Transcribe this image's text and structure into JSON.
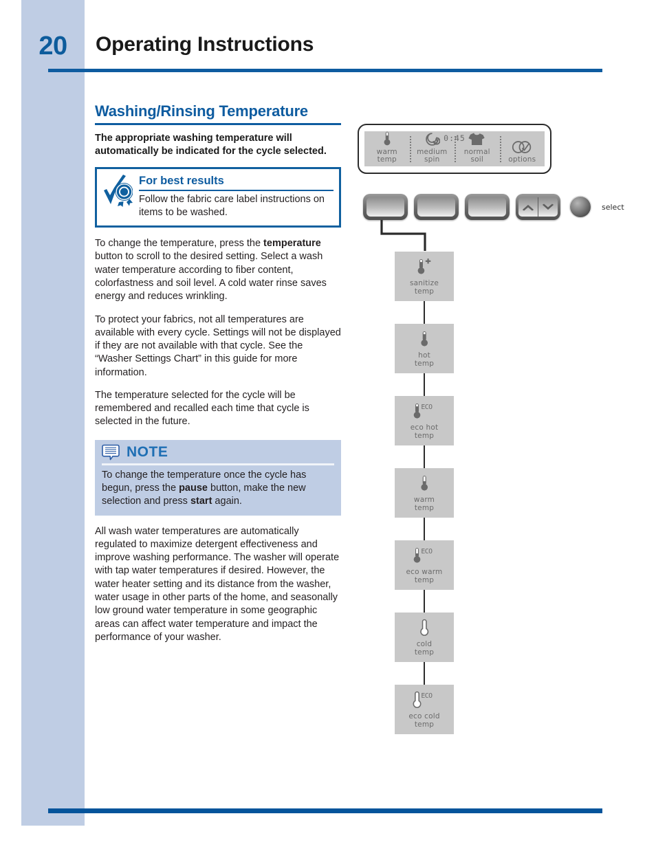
{
  "page": {
    "number": "20",
    "title": "Operating Instructions"
  },
  "section": {
    "heading": "Washing/Rinsing Temperature",
    "lead": "The appropriate washing temperature will automatically be indicated for the cycle selected.",
    "paragraphs": [
      {
        "parts": [
          {
            "text": "To change the temperature, press the ",
            "bold": false
          },
          {
            "text": "temperature",
            "bold": true
          },
          {
            "text": " button to scroll to the desired setting. Select a wash water temperature according to fiber content, colorfastness and soil level. A cold water rinse saves energy and reduces wrinkling.",
            "bold": false
          }
        ]
      },
      {
        "parts": [
          {
            "text": "To protect your fabrics, not all temperatures are available with every cycle. Settings will not be displayed if they are not available with that cycle. See the “Washer Settings Chart” in this guide for more information.",
            "bold": false
          }
        ]
      },
      {
        "parts": [
          {
            "text": "The temperature selected for the cycle will be remembered and recalled each time that cycle is selected in the future.",
            "bold": false
          }
        ]
      }
    ],
    "closing": {
      "parts": [
        {
          "text": "All wash water temperatures are automatically regulated to maximize detergent effectiveness and improve washing performance. The washer will operate with tap water temperatures if desired. However, the water heater setting and its distance from the washer, water usage in other parts of the home, and seasonally low ground water temperature in some geographic areas can affect water temperature and impact the performance of your washer.",
          "bold": false
        }
      ]
    }
  },
  "tip_box": {
    "icon": "award-rosette-checkmark-icon",
    "title": "For best results",
    "text": "Follow the fabric care label instructions on items to be washed."
  },
  "note_box": {
    "icon": "note-speech-bubble-icon",
    "title": "NOTE",
    "parts": [
      {
        "text": "To change the temperature once the cycle has begun, press the ",
        "bold": false
      },
      {
        "text": "pause",
        "bold": true
      },
      {
        "text": " button, make the new selection and press ",
        "bold": false
      },
      {
        "text": "start",
        "bold": true
      },
      {
        "text": " again.",
        "bold": false
      }
    ]
  },
  "control_panel": {
    "display": {
      "timer": "0:45",
      "cells": [
        {
          "icon": "thermometer-warm-icon",
          "label": "warm\ntemp"
        },
        {
          "icon": "spin-spiral-icon",
          "label": "medium\nspin"
        },
        {
          "icon": "tshirt-soil-icon",
          "label": "normal\nsoil"
        },
        {
          "icon": "options-circles-icon",
          "label": "options"
        }
      ]
    },
    "buttons": [
      {
        "name": "temperature-button",
        "type": "plain"
      },
      {
        "name": "spin-button",
        "type": "plain"
      },
      {
        "name": "soil-button",
        "type": "plain"
      },
      {
        "name": "scroll-rocker-button",
        "type": "rocker",
        "up_icon": "chevron-up-icon",
        "down_icon": "chevron-down-icon"
      }
    ],
    "knob": {
      "icon": "select-knob-icon",
      "label": "select"
    }
  },
  "flow": {
    "steps": [
      {
        "icon": "thermometer-sanitize-plus-icon",
        "label": "sanitize\ntemp"
      },
      {
        "icon": "thermometer-hot-icon",
        "label": "hot\ntemp"
      },
      {
        "icon": "thermometer-eco-hot-icon",
        "label": "eco hot\ntemp"
      },
      {
        "icon": "thermometer-warm-icon",
        "label": "warm\ntemp"
      },
      {
        "icon": "thermometer-eco-warm-icon",
        "label": "eco warm\ntemp"
      },
      {
        "icon": "thermometer-cold-icon",
        "label": "cold\ntemp"
      },
      {
        "icon": "thermometer-eco-cold-icon",
        "label": "eco cold\ntemp"
      }
    ]
  },
  "colors": {
    "brand_blue": "#0e5ca0",
    "pale_blue": "#bfcde4",
    "lcd_gray": "#c8c8c8",
    "lcd_text": "#6b6b6b"
  }
}
